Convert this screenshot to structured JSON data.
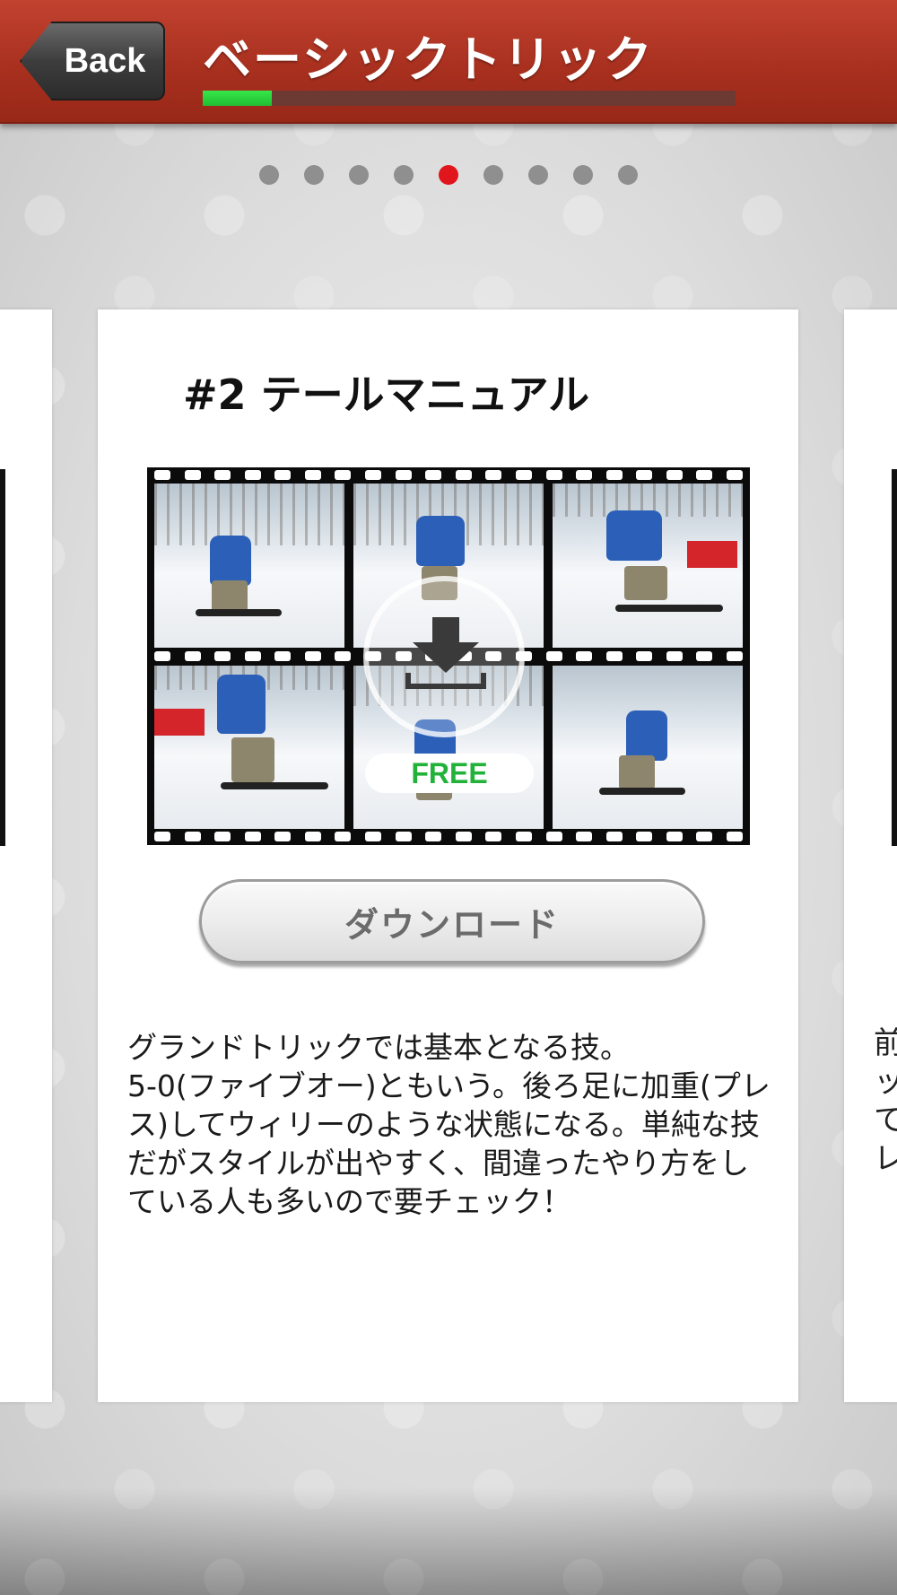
{
  "header": {
    "back_label": "Back",
    "title": "ベーシックトリック",
    "progress_fraction": 0.13
  },
  "pager": {
    "total": 9,
    "active_index": 4
  },
  "card": {
    "title": "#2 テールマニュアル",
    "badge": "FREE",
    "download_label": "ダウンロード",
    "description": "グランドトリックでは基本となる技。\n5-0(ファイブオー)ともいう。後ろ足に加重(プレス)してウィリーのような状態になる。単純な技だがスタイルが出やすく、間違ったやり方をしている人も多いので要チェック！"
  },
  "right_card_peek": "前\nッ\nて\nレ",
  "colors": {
    "header_red": "#a9301f",
    "active_dot": "#e0161c",
    "progress_green": "#2ad33f",
    "free_green": "#22b23a"
  },
  "icons": {
    "download": "download-arrow-icon"
  }
}
